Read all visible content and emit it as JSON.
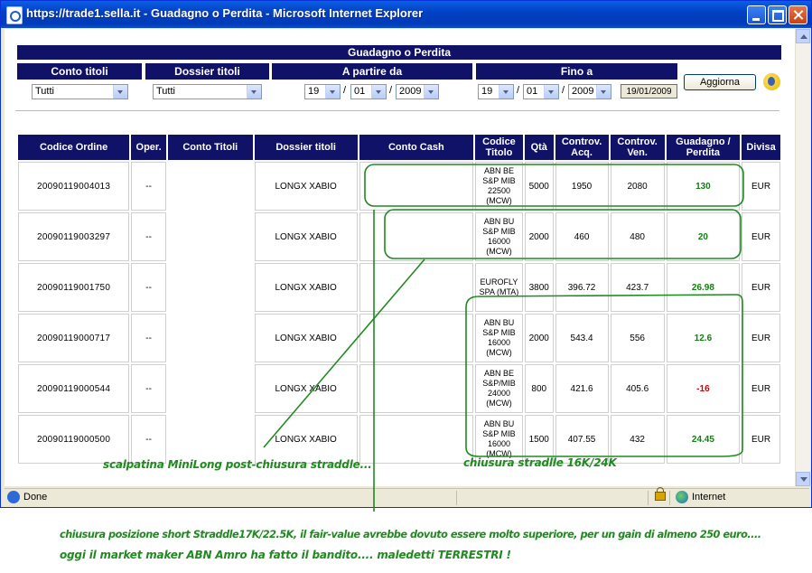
{
  "window": {
    "title": "https://trade1.sella.it - Guadagno o Perdita - Microsoft Internet Explorer"
  },
  "page": {
    "heading": "Guadagno o Perdita"
  },
  "filters": {
    "conto_label": "Conto titoli",
    "conto_value": "Tutti",
    "dossier_label": "Dossier titoli",
    "dossier_value": "Tutti",
    "from_label": "A partire da",
    "from_day": "19",
    "from_month": "01",
    "from_year": "2009",
    "to_label": "Fino a",
    "to_day": "19",
    "to_month": "01",
    "to_year": "2009",
    "date_display": "19/01/2009",
    "sep": "/",
    "refresh_button": "Aggiorna"
  },
  "table": {
    "headers": {
      "codice": "Codice Ordine",
      "oper": "Oper.",
      "conto": "Conto Titoli",
      "dossier": "Dossier titoli",
      "cash": "Conto Cash",
      "titolo": "Codice Titolo",
      "qta": "Qtà",
      "acq": "Controv. Acq.",
      "ven": "Controv. Ven.",
      "gp": "Guadagno / Perdita",
      "divisa": "Divisa"
    },
    "rows": [
      {
        "codice": "20090119004013",
        "oper": "--",
        "conto": "",
        "dossier": "LONGX XABIO",
        "cash": "",
        "titolo": "ABN BE S&P MIB 22500 (MCW)",
        "qta": "5000",
        "acq": "1950",
        "ven": "2080",
        "gp": "130",
        "divisa": "EUR"
      },
      {
        "codice": "20090119003297",
        "oper": "--",
        "conto": "",
        "dossier": "LONGX XABIO",
        "cash": "",
        "titolo": "ABN BU S&P MIB 16000 (MCW)",
        "qta": "2000",
        "acq": "460",
        "ven": "480",
        "gp": "20",
        "divisa": "EUR"
      },
      {
        "codice": "20090119001750",
        "oper": "--",
        "conto": "",
        "dossier": "LONGX XABIO",
        "cash": "",
        "titolo": "EUROFLY SPA (MTA)",
        "qta": "3800",
        "acq": "396.72",
        "ven": "423.7",
        "gp": "26.98",
        "divisa": "EUR"
      },
      {
        "codice": "20090119000717",
        "oper": "--",
        "conto": "",
        "dossier": "LONGX XABIO",
        "cash": "",
        "titolo": "ABN BU S&P MIB 16000 (MCW)",
        "qta": "2000",
        "acq": "543.4",
        "ven": "556",
        "gp": "12.6",
        "divisa": "EUR"
      },
      {
        "codice": "20090119000544",
        "oper": "--",
        "conto": "",
        "dossier": "LONGX XABIO",
        "cash": "",
        "titolo": "ABN BE S&P/MIB 24000 (MCW)",
        "qta": "800",
        "acq": "421.6",
        "ven": "405.6",
        "gp": "-16",
        "divisa": "EUR"
      },
      {
        "codice": "20090119000500",
        "oper": "--",
        "conto": "",
        "dossier": "LONGX XABIO",
        "cash": "",
        "titolo": "ABN BU S&P MIB 16000 (MCW)",
        "qta": "1500",
        "acq": "407.55",
        "ven": "432",
        "gp": "24.45",
        "divisa": "EUR"
      }
    ]
  },
  "status": {
    "left": "Done",
    "zone": "Internet"
  },
  "annotations": {
    "scalpatina": "scalpatina MiniLong post-chiusura straddle...",
    "stradlle": "chiusura stradlle 16K/24K",
    "line1": "chiusura posizione short Straddle17K/22.5K, il fair-value avrebbe dovuto essere molto superiore, per un gain di almeno 250 euro....",
    "line2": "oggi il market maker ABN Amro ha fatto il bandito.... maledetti TERRESTRI !"
  },
  "colors": {
    "header_bg": "#101268",
    "gain": "#108010",
    "loss": "#d00000",
    "annotation": "#1f8a1f"
  }
}
